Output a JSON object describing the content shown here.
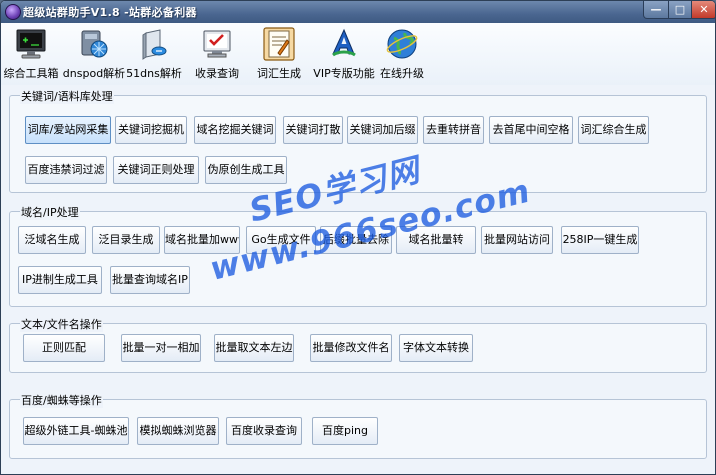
{
  "window": {
    "title": "超级站群助手V1.8 -站群必备利器",
    "min_glyph": "—",
    "max_glyph": "□",
    "close_glyph": "✕"
  },
  "toolbar": [
    {
      "label": "综合工具箱",
      "icon": "monitor-icon"
    },
    {
      "label": "dnspod解析",
      "icon": "network-gear-icon"
    },
    {
      "label": "51dns解析",
      "icon": "server-icon"
    },
    {
      "label": "收录查询",
      "icon": "checklist-icon"
    },
    {
      "label": "词汇生成",
      "icon": "notepad-icon"
    },
    {
      "label": "VIP专版功能",
      "icon": "vip-letter-icon"
    },
    {
      "label": "在线升级",
      "icon": "globe-icon"
    }
  ],
  "groups": {
    "keywords": {
      "title": "关键词/语料库处理",
      "buttons": [
        "词库/爱站网采集",
        "关键词挖掘机",
        "域名挖掘关键词",
        "关键词打散",
        "关键词加后缀",
        "去重转拼音",
        "去首尾中间空格",
        "词汇综合生成",
        "百度违禁词过滤",
        "关键词正则处理",
        "伪原创生成工具"
      ]
    },
    "domain": {
      "title": "域名/IP处理",
      "buttons": [
        "泛域名生成",
        "泛目录生成",
        "域名批量加www",
        "Go生成文件",
        "后缀批量去除",
        "域名批量转",
        "批量网站访问",
        "258IP一键生成",
        "IP进制生成工具",
        "批量查询域名IP"
      ]
    },
    "text": {
      "title": "文本/文件名操作",
      "buttons": [
        "正则匹配",
        "批量一对一相加",
        "批量取文本左边",
        "批量修改文件名",
        "字体文本转换"
      ]
    },
    "baidu": {
      "title": "百度/蜘蛛等操作",
      "buttons": [
        "超级外链工具-蜘蛛池",
        "模拟蜘蛛浏览器",
        "百度收录查询",
        "百度ping"
      ]
    }
  },
  "watermark": {
    "line1": "SEO学习网",
    "line2": "www.966seo.com"
  }
}
